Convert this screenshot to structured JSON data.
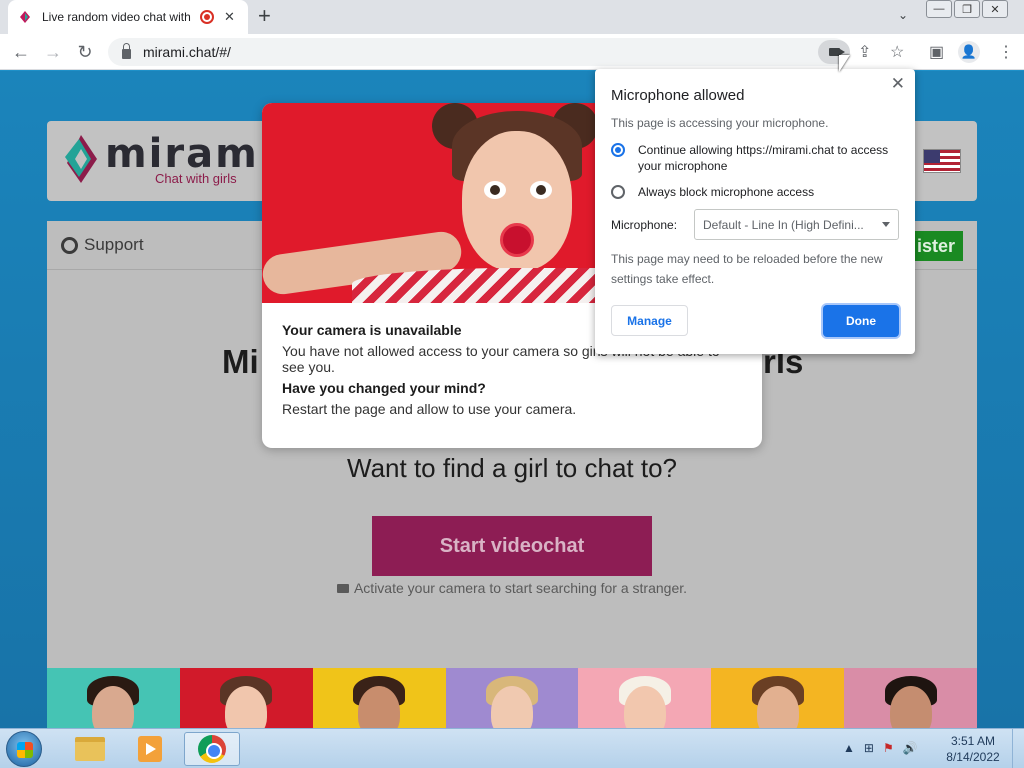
{
  "browser": {
    "tab_title": "Live random video chat with",
    "tab_close": "✕",
    "new_tab": "+",
    "tab_search": "⌄",
    "window_minimize": "—",
    "window_restore": "❐",
    "window_close": "✕",
    "url": "mirami.chat/#/",
    "back": "←",
    "forward": "→",
    "reload": "↻",
    "share": "⇪",
    "bookmark": "☆",
    "sidepanel": "▣",
    "menu": "⋮",
    "profile": "👤"
  },
  "site": {
    "logo_text": "mirami",
    "logo_tagline": "Chat with girls",
    "support_label": "Support",
    "register_label": "ister",
    "hero_title_left": "Mi",
    "hero_title_right": "rls",
    "hero_subtitle": "Want to find a girl to chat to?",
    "start_button": "Start videochat",
    "activate_hint": "Activate your camera to start searching for a stranger.",
    "thumbnails": [
      {
        "bg": "#45c4b4",
        "hair": "#2a1a12",
        "skin": "#d9a98f"
      },
      {
        "bg": "#d11a2a",
        "hair": "#5b3526",
        "skin": "#f1c6ad"
      },
      {
        "bg": "#f0c419",
        "hair": "#3a2218",
        "skin": "#c88d6d"
      },
      {
        "bg": "#9f8ad0",
        "hair": "#d8b77a",
        "skin": "#f0c9b0"
      },
      {
        "bg": "#f4a7b4",
        "hair": "#f5f0e6",
        "skin": "#f2c7ae"
      },
      {
        "bg": "#f4b522",
        "hair": "#6a3f24",
        "skin": "#e2b090"
      },
      {
        "bg": "#d98da7",
        "hair": "#1e1410",
        "skin": "#c58d70"
      }
    ]
  },
  "camera_modal": {
    "heading1": "Your camera is unavailable",
    "para1": "You have not allowed access to your camera so girls will not be able to see you.",
    "heading2": "Have you changed your mind?",
    "para2": "Restart the page and allow to use your camera."
  },
  "permission": {
    "title": "Microphone allowed",
    "close": "✕",
    "subtitle": "This page is accessing your microphone.",
    "option_allow": "Continue allowing https://mirami.chat to access your microphone",
    "option_block": "Always block microphone access",
    "selected": "allow",
    "mic_label": "Microphone:",
    "mic_value": "Default - Line In (High Defini...",
    "note": "This page may need to be reloaded before the new settings take effect.",
    "manage_button": "Manage",
    "done_button": "Done"
  },
  "taskbar": {
    "tray_icons": [
      "▲",
      "⊞",
      "⚑",
      "🔊"
    ],
    "time": "3:51 AM",
    "date": "8/14/2022"
  },
  "colors": {
    "accent_blue": "#1a73e8",
    "start_button": "#8d1d54",
    "register_green": "#1a8a22",
    "page_bg": "#1b84bb"
  }
}
